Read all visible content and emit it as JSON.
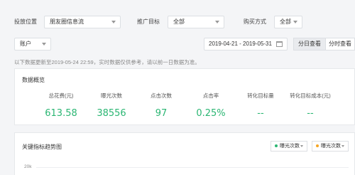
{
  "filters": {
    "placement_label": "投放位置",
    "placement_value": "朋友圈信息流",
    "target_label": "推广目标",
    "target_value": "全部",
    "purchase_label": "购买方式",
    "purchase_value": "全部",
    "account_value": "账户",
    "date_range": "2019-04-21 - 2019-05-31",
    "daily_view_label": "分日查看",
    "hourly_view_label": "分时查看"
  },
  "notice": "以下数据更新至2019-05-24 22:59，实时数据仅供参考，请以前一日数据为准。",
  "overview": {
    "title": "数据概览",
    "metrics": [
      {
        "label": "总花费(元)",
        "value": "613.58"
      },
      {
        "label": "曝光次数",
        "value": "38556"
      },
      {
        "label": "点击次数",
        "value": "97"
      },
      {
        "label": "点击率",
        "value": "0.25%"
      },
      {
        "label": "转化目标量",
        "value": "--"
      },
      {
        "label": "转化目标成本(元)",
        "value": "--"
      }
    ]
  },
  "trend": {
    "title": "关键指标趋势图",
    "series1_label": "曝光次数",
    "series1_color": "#2bb673",
    "series2_label": "曝光次数",
    "series2_color": "#f5a623",
    "y_tick": "20k"
  }
}
